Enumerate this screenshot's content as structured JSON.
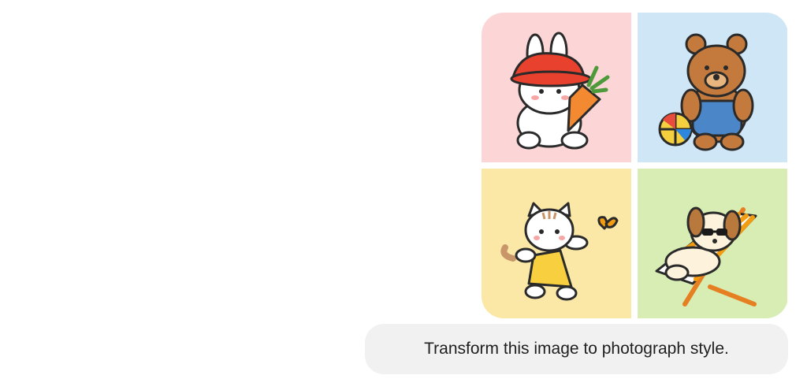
{
  "message": {
    "text": "Transform this image to photograph style."
  },
  "image": {
    "tiles": [
      {
        "subject": "bunny-with-carrot",
        "background": "#fcd6d6"
      },
      {
        "subject": "bear-with-ball",
        "background": "#cfe6f7"
      },
      {
        "subject": "cat-with-butterfly",
        "background": "#fbe8a6"
      },
      {
        "subject": "dog-on-beach-chair",
        "background": "#d8edb3"
      }
    ]
  }
}
